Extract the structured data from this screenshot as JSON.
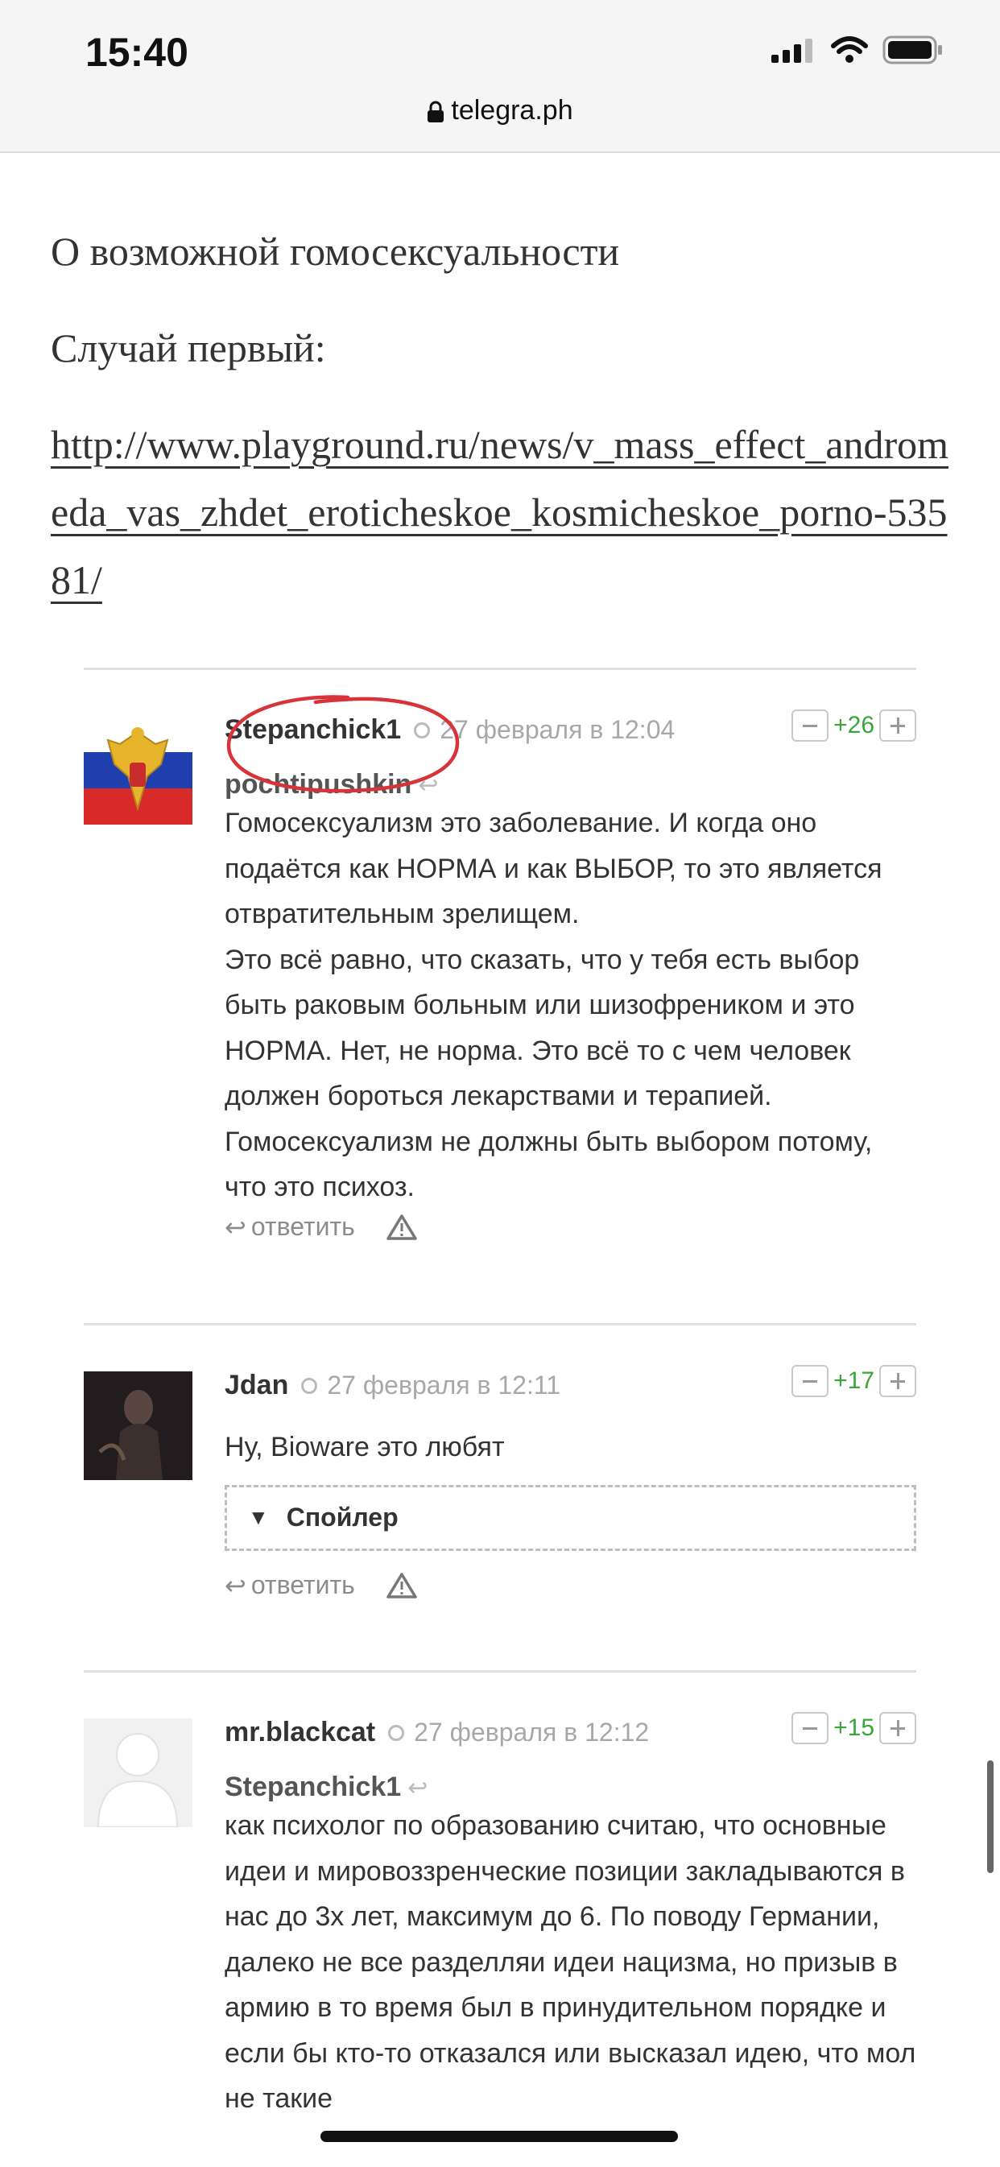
{
  "status": {
    "time": "15:40"
  },
  "browser": {
    "url": "telegra.ph"
  },
  "article": {
    "title": "О возможной гомосексуальности",
    "case": "Случай первый:",
    "link": "http://www.playground.ru/news/v_mass_effect_andromeda_vas_zhdet_eroticheskoe_kosmicheskoe_porno-53581/"
  },
  "comments": [
    {
      "author": "Stepanchick1",
      "date": "27 февраля в 12:04",
      "score": "+26",
      "reply_to": "pochtipushkin",
      "text": "Гомосексуализм это заболевание. И когда оно подаётся как НОРМА и как ВЫБОР, то это является отвратительным зрелищем.\nЭто всё равно, что сказать, что у тебя есть выбор быть раковым больным или шизофреником и это НОРМА. Нет, не норма. Это всё то с чем человек должен бороться лекарствами и терапией. Гомосексуализм не должны быть выбором потому, что это психоз.",
      "reply_label": "ответить"
    },
    {
      "author": "Jdan",
      "date": "27 февраля в 12:11",
      "score": "+17",
      "text": "Ну, Bioware это любят",
      "spoiler": "Спойлер",
      "reply_label": "ответить"
    },
    {
      "author": "mr.blackcat",
      "date": "27 февраля в 12:12",
      "score": "+15",
      "reply_to": "Stepanchick1",
      "text": "как психолог по образованию считаю, что основные идеи и мировоззренческие позиции закладываются в нас до 3х лет, максимум до 6. По поводу Германии, далеко не все разделляи идеи нацизма, но призыв в армию в то время был в принудительном порядке и если бы кто-то отказался или высказал идею, что мол не такие"
    }
  ],
  "colors": {
    "score": "#3aa53a",
    "annotation": "#d9333a"
  },
  "icons": [
    "signal-icon",
    "wifi-icon",
    "battery-icon",
    "lock-icon",
    "reply-arrow-icon",
    "warning-icon",
    "chevron-down-icon"
  ]
}
